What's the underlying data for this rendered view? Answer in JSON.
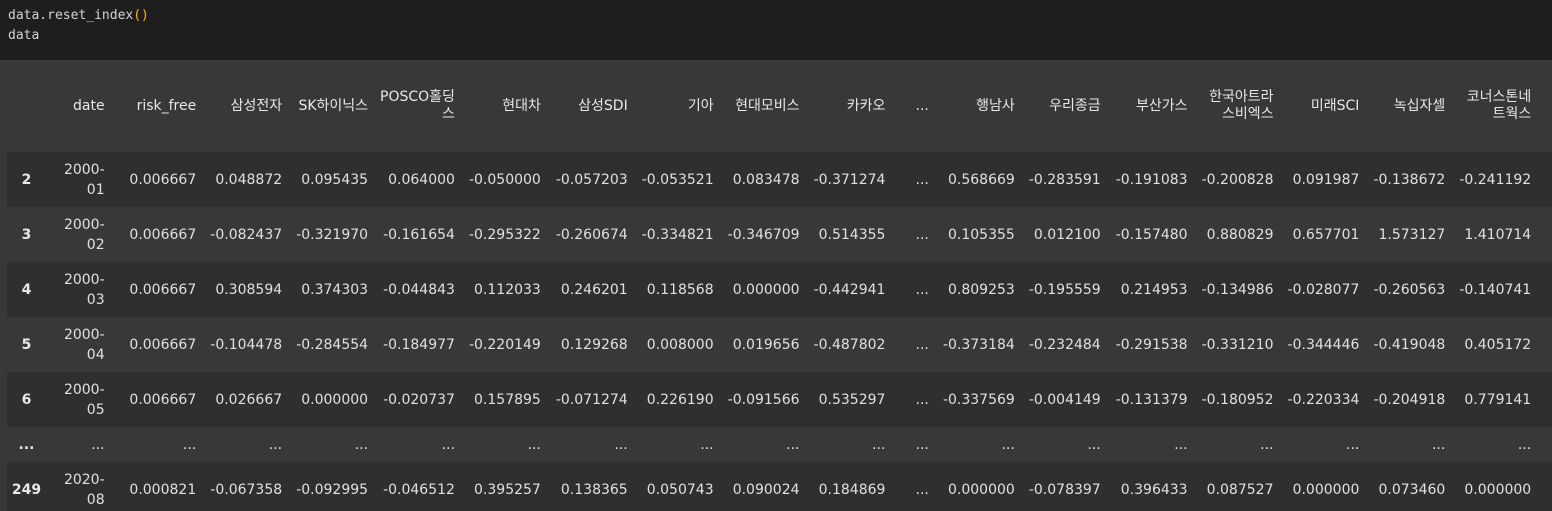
{
  "code": {
    "line1_before": "data.reset_index",
    "line1_parens": "()",
    "line2": "data"
  },
  "table": {
    "columns": [
      "date",
      "risk_free",
      "삼성전자",
      "SK하이닉스",
      "POSCO홀딩스",
      "현대차",
      "삼성SDI",
      "기아",
      "현대모비스",
      "카카오",
      "...",
      "행남사",
      "우리종금",
      "부산가스",
      "한국아트라스비엑스",
      "미래SCI",
      "녹십자셀",
      "코너스톤네트웍스"
    ],
    "rows": [
      {
        "index": "2",
        "cells": [
          "2000-01",
          "0.006667",
          "0.048872",
          "0.095435",
          "0.064000",
          "-0.050000",
          "-0.057203",
          "-0.053521",
          "0.083478",
          "-0.371274",
          "...",
          "0.568669",
          "-0.283591",
          "-0.191083",
          "-0.200828",
          "0.091987",
          "-0.138672",
          "-0.241192"
        ]
      },
      {
        "index": "3",
        "cells": [
          "2000-02",
          "0.006667",
          "-0.082437",
          "-0.321970",
          "-0.161654",
          "-0.295322",
          "-0.260674",
          "-0.334821",
          "-0.346709",
          "0.514355",
          "...",
          "0.105355",
          "0.012100",
          "-0.157480",
          "0.880829",
          "0.657701",
          "1.573127",
          "1.410714"
        ]
      },
      {
        "index": "4",
        "cells": [
          "2000-03",
          "0.006667",
          "0.308594",
          "0.374303",
          "-0.044843",
          "0.112033",
          "0.246201",
          "0.118568",
          "0.000000",
          "-0.442941",
          "...",
          "0.809253",
          "-0.195559",
          "0.214953",
          "-0.134986",
          "-0.028077",
          "-0.260563",
          "-0.140741"
        ]
      },
      {
        "index": "5",
        "cells": [
          "2000-04",
          "0.006667",
          "-0.104478",
          "-0.284554",
          "-0.184977",
          "-0.220149",
          "0.129268",
          "0.008000",
          "0.019656",
          "-0.487802",
          "...",
          "-0.373184",
          "-0.232484",
          "-0.291538",
          "-0.331210",
          "-0.344446",
          "-0.419048",
          "0.405172"
        ]
      },
      {
        "index": "6",
        "cells": [
          "2000-05",
          "0.006667",
          "0.026667",
          "0.000000",
          "-0.020737",
          "0.157895",
          "-0.071274",
          "0.226190",
          "-0.091566",
          "0.535297",
          "...",
          "-0.337569",
          "-0.004149",
          "-0.131379",
          "-0.180952",
          "-0.220334",
          "-0.204918",
          "0.779141"
        ]
      },
      {
        "index": "...",
        "cells": [
          "...",
          "...",
          "...",
          "...",
          "...",
          "...",
          "...",
          "...",
          "...",
          "...",
          "...",
          "...",
          "...",
          "...",
          "...",
          "...",
          "...",
          "..."
        ]
      },
      {
        "index": "249",
        "cells": [
          "2020-08",
          "0.000821",
          "-0.067358",
          "-0.092995",
          "-0.046512",
          "0.395257",
          "0.138365",
          "0.050743",
          "0.090024",
          "0.184869",
          "...",
          "0.000000",
          "-0.078397",
          "0.396433",
          "0.087527",
          "0.000000",
          "0.073460",
          "0.000000"
        ]
      }
    ]
  }
}
